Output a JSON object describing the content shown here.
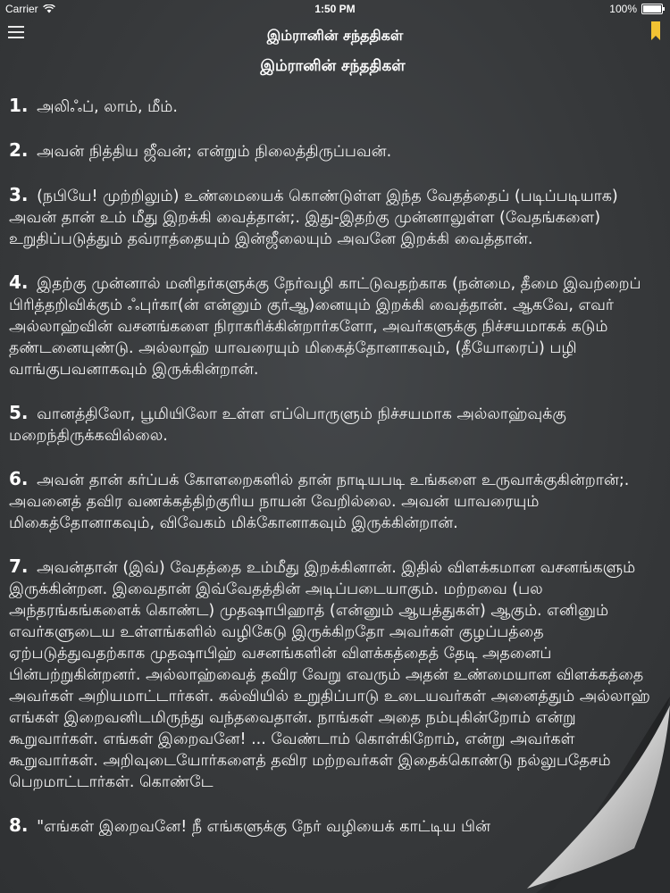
{
  "status_bar": {
    "carrier": "Carrier",
    "time": "1:50 PM",
    "battery": "100%"
  },
  "nav": {
    "title": "இம்ரானின் சந்ததிகள்",
    "menu_icon": "hamburger-menu-icon",
    "bookmark_icon": "bookmark-icon",
    "bookmark_color": "#f2c233"
  },
  "surah": {
    "title": "இம்ரானின் சந்ததிகள்"
  },
  "verses": [
    {
      "num": "1.",
      "text": "அலிஃப், லாம், மீம்."
    },
    {
      "num": "2.",
      "text": "அவன் நித்திய ஜீவன்; என்றும் நிலைத்திருப்பவன்."
    },
    {
      "num": "3.",
      "text": "(நபியே! முற்றிலும்) உண்மையைக் கொண்டுள்ள இந்த வேதத்தைப் (படிப்படியாக) அவன் தான் உம் மீது இறக்கி வைத்தான்;. இது-இதற்கு முன்னாலுள்ள (வேதங்களை) உறுதிப்படுத்தும் தவ்ராத்தையும் இன்ஜீலையும் அவனே இறக்கி வைத்தான்."
    },
    {
      "num": "4.",
      "text": "இதற்கு முன்னால் மனிதர்களுக்கு நேர்வழி காட்டுவதற்காக (நன்மை, தீமை இவற்றைப் பிரித்தறிவிக்கும் ஃபுர்கா(ன் என்னும் குர்ஆ)னையும் இறக்கி வைத்தான். ஆகவே, எவர் அல்லாஹ்வின் வசனங்களை நிராகரிக்கின்றார்களோ, அவர்களுக்கு நிச்சயமாகக் கடும் தண்டனையுண்டு. அல்லாஹ் யாவரையும் மிகைத்தோனாகவும், (தீயோரைப்) பழி வாங்குபவனாகவும் இருக்கின்றான்."
    },
    {
      "num": "5.",
      "text": "வானத்திலோ, பூமியிலோ உள்ள எப்பொருளும் நிச்சயமாக அல்லாஹ்வுக்கு மறைந்திருக்கவில்லை."
    },
    {
      "num": "6.",
      "text": "அவன் தான் கர்ப்பக் கோளறைகளில் தான் நாடியபடி உங்களை உருவாக்குகின்றான்;. அவனைத் தவிர வணக்கத்திற்குரிய நாயன் வேறில்லை. அவன் யாவரையும் மிகைத்தோனாகவும், விவேகம் மிக்கோனாகவும் இருக்கின்றான்."
    },
    {
      "num": "7.",
      "text": "அவன்தான் (இவ்) வேதத்தை உம்மீது இறக்கினான். இதில் விளக்கமான வசனங்களும் இருக்கின்றன. இவைதான் இவ்வேதத்தின் அடிப்படையாகும். மற்றவை (பல அந்தரங்கங்களைக் கொண்ட) முதஷாபிஹாத் (என்னும் ஆயத்துகள்) ஆகும். எனினும் எவர்களுடைய உள்ளங்களில் வழிகேடு இருக்கிறதோ அவர்கள் குழப்பத்தை ஏற்படுத்துவதற்காக முதஷாபிஹ் வசனங்களின் விளக்கத்தைத் தேடி அதனைப் பின்பற்றுகின்றனர். அல்லாஹ்வைத் தவிர வேறு எவரும் அதன் உண்மையான விளக்கத்தை அவர்கள் அறியமாட்டார்கள். கல்வியில் உறுதிப்பாடு உடையவர்கள் அனைத்தும் அல்லாஹ் எங்கள் இறைவனிடமிருந்து வந்தவைதான். நாங்கள் அதை நம்புகின்றோம் என்று கூறுவார்கள். எங்கள் இறைவனே! ... வேண்டாம் கொள்கிறோம், என்று அவர்கள் கூறுவார்கள். அறிவுடையோர்களைத் தவிர மற்றவர்கள் இதைக்கொண்டு நல்லுபதேசம் பெறமாட்டார்கள். கொண்டே"
    },
    {
      "num": "8.",
      "text": "\"எங்கள் இறைவனே! நீ எங்களுக்கு நேர் வழியைக் காட்டிய பின்"
    }
  ]
}
